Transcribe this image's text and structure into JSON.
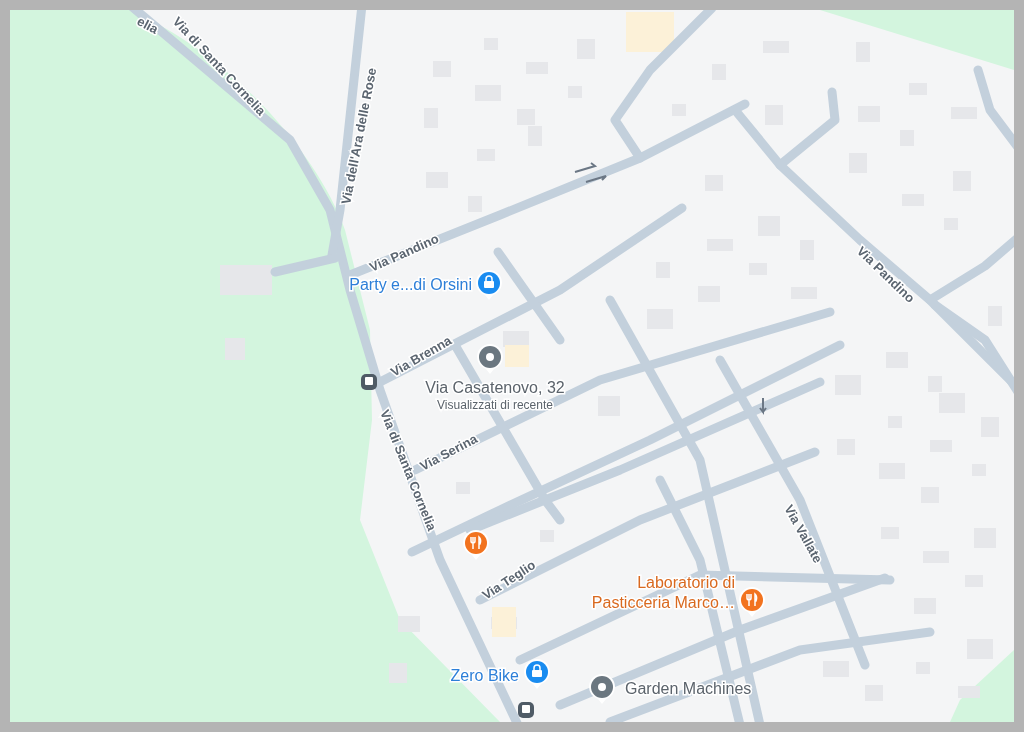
{
  "map": {
    "road_labels": [
      "elia",
      "Via di Santa Cornelia",
      "Via dell'Ara delle Rose",
      "Via Pandino",
      "Via Pandino",
      "Via Brenna",
      "Via Serina",
      "Via di Santa Cornelia",
      "Via Teglio",
      "Via Vallate"
    ],
    "places": [
      {
        "kind": "shop",
        "label": [
          "Party e...di Orsini"
        ]
      },
      {
        "kind": "place",
        "label": [
          "Via Casatenovo, 32"
        ],
        "note": "Visualizzati di recente"
      },
      {
        "kind": "restaurant"
      },
      {
        "kind": "restaurant",
        "label": [
          "Laboratorio di",
          "Pasticceria Marco…"
        ]
      },
      {
        "kind": "shop",
        "label": [
          "Zero Bike"
        ]
      },
      {
        "kind": "place",
        "label": [
          "Garden Machines"
        ]
      }
    ]
  }
}
